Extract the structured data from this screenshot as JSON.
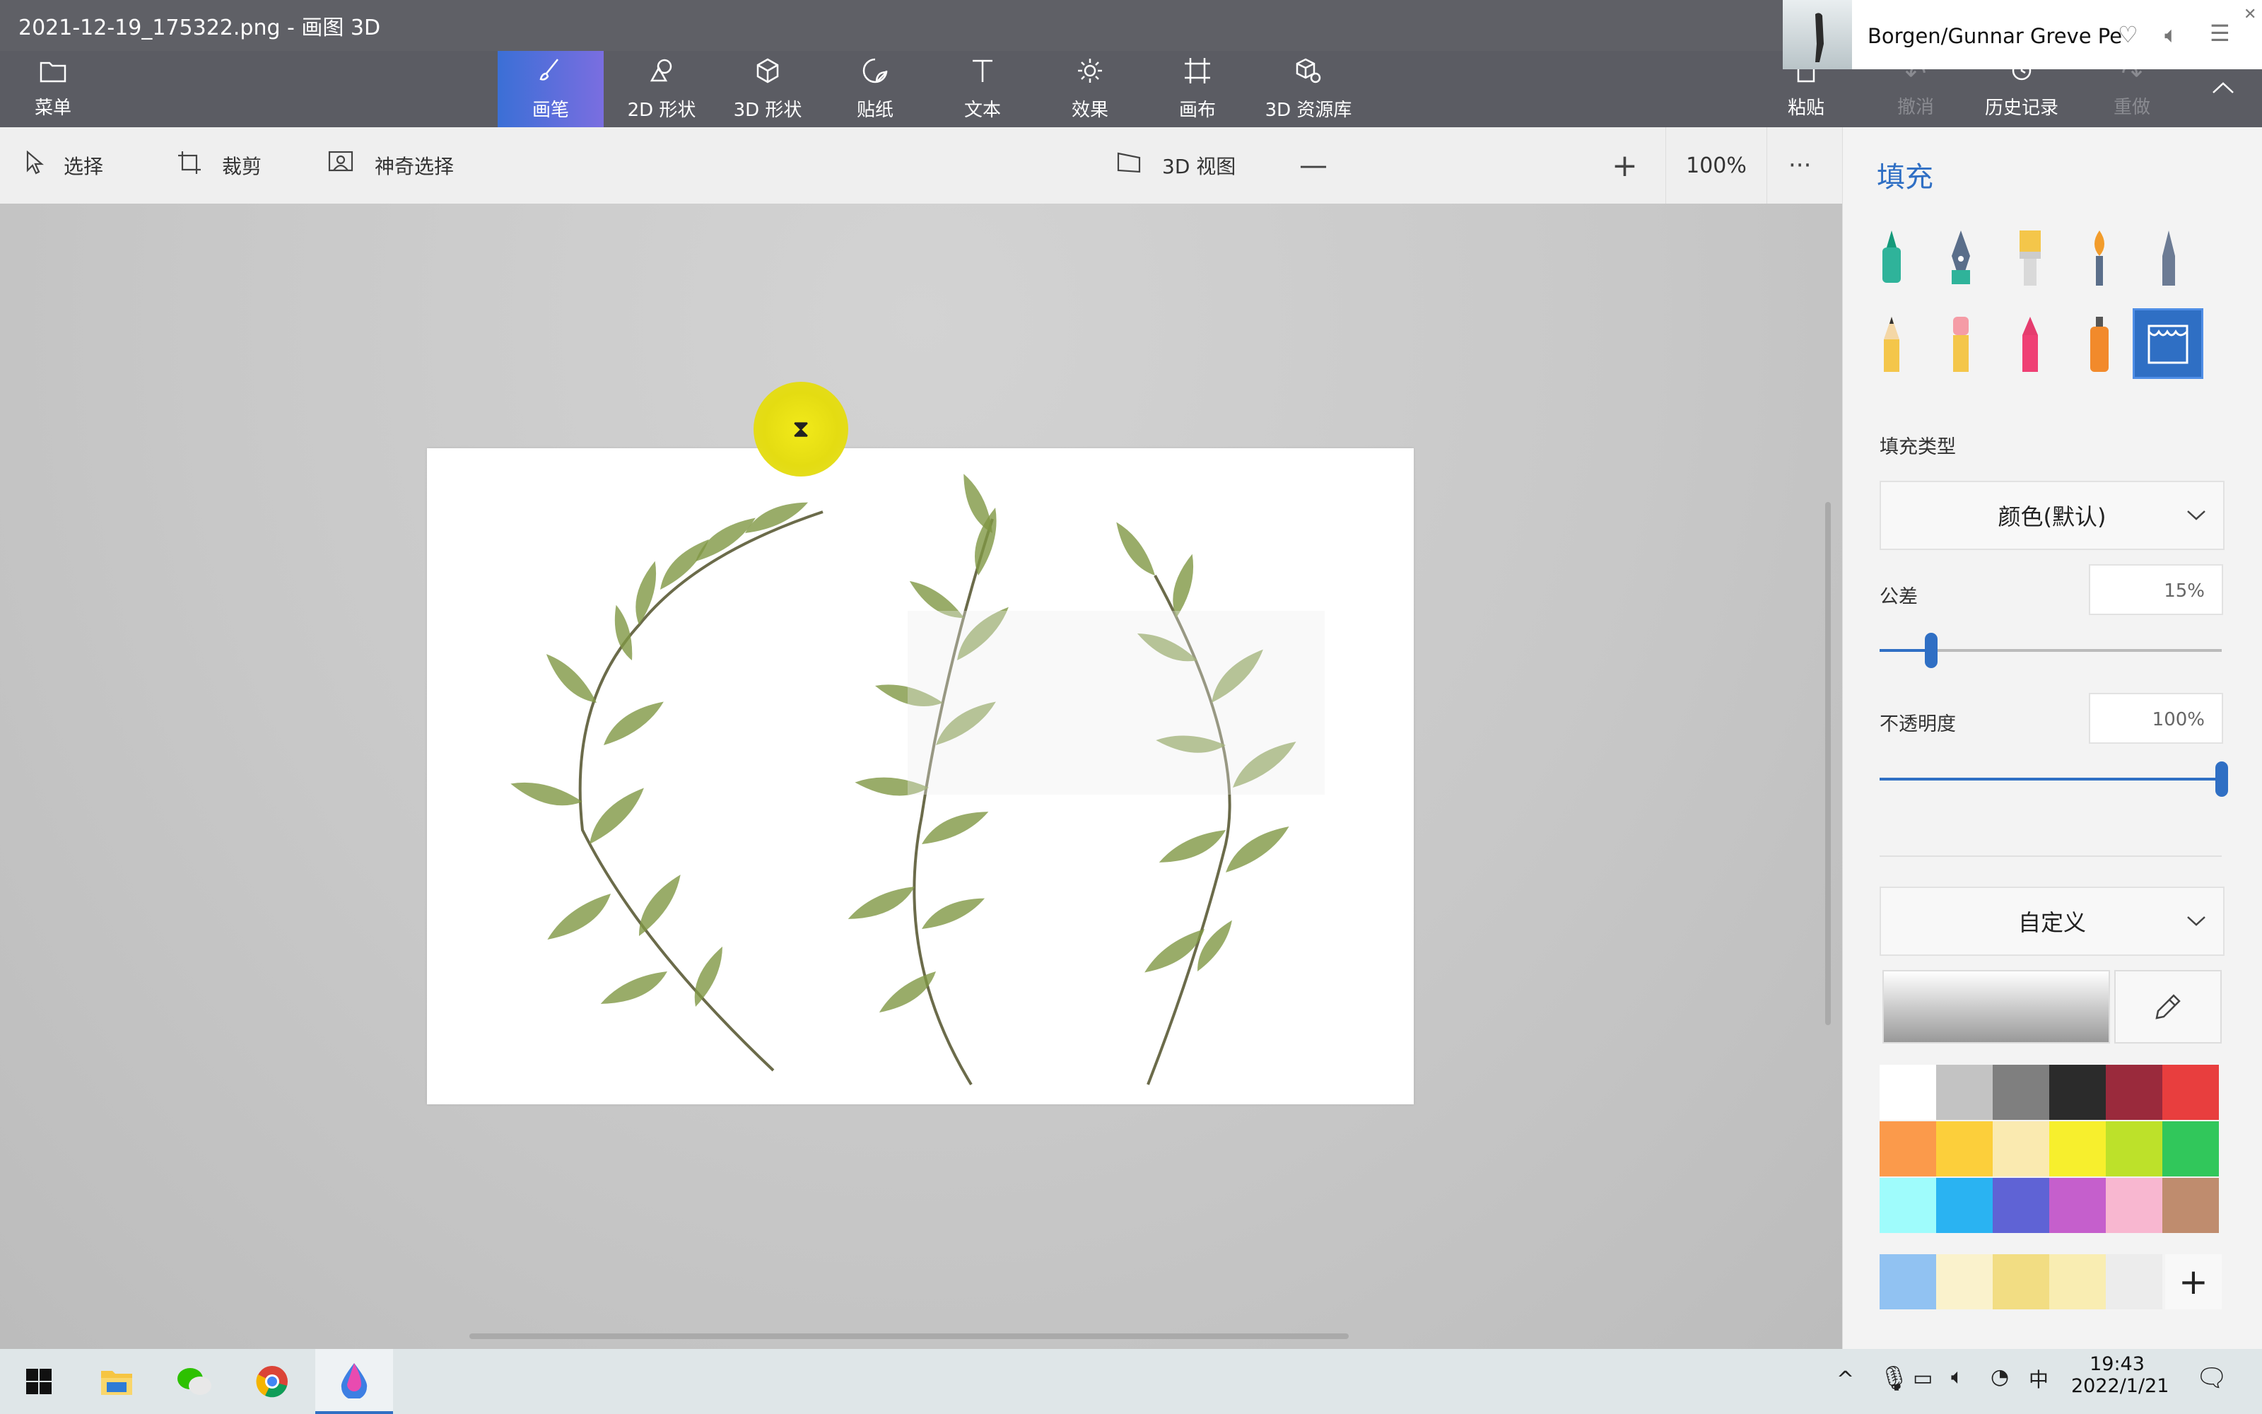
{
  "window": {
    "title": "2021-12-19_175322.png - 画图 3D"
  },
  "media": {
    "track": "Borgen/Gunnar Greve Pe"
  },
  "ribbon": {
    "menu": "菜单",
    "tools": [
      {
        "label": "画笔"
      },
      {
        "label": "2D 形状"
      },
      {
        "label": "3D 形状"
      },
      {
        "label": "贴纸"
      },
      {
        "label": "文本"
      },
      {
        "label": "效果"
      },
      {
        "label": "画布"
      },
      {
        "label": "3D 资源库"
      }
    ],
    "right": [
      {
        "label": "粘贴"
      },
      {
        "label": "撤消"
      },
      {
        "label": "历史记录"
      },
      {
        "label": "重做"
      }
    ]
  },
  "toolbar": {
    "select": "选择",
    "crop": "裁剪",
    "magic_select": "神奇选择",
    "view3d": "3D 视图",
    "zoom": "100%",
    "zoom_level": 0.5
  },
  "panel": {
    "title": "填充",
    "fill_type_label": "填充类型",
    "fill_type_value": "颜色(默认)",
    "tolerance_label": "公差",
    "tolerance_value": "15%",
    "tolerance_level": 0.15,
    "opacity_label": "不透明度",
    "opacity_value": "100%",
    "opacity_level": 1.0,
    "color_mode": "自定义",
    "palette": [
      "#ffffff",
      "#c3c3c3",
      "#7f7f7f",
      "#2b2b2b",
      "#9a2a3c",
      "#e83e3e",
      "#fb9a4b",
      "#fccf3b",
      "#faeab0",
      "#f7ef2d",
      "#bde12a",
      "#31c75b",
      "#9ffcfc",
      "#2ab3f2",
      "#5f63d5",
      "#c55fcc",
      "#f8b7d0",
      "#bf8c6e"
    ],
    "recent": [
      "#91c2f2",
      "#faf2cc",
      "#f2dd83",
      "#f9edb2",
      "#ececec"
    ]
  },
  "taskbar": {
    "time": "19:43",
    "date": "2022/1/21"
  }
}
